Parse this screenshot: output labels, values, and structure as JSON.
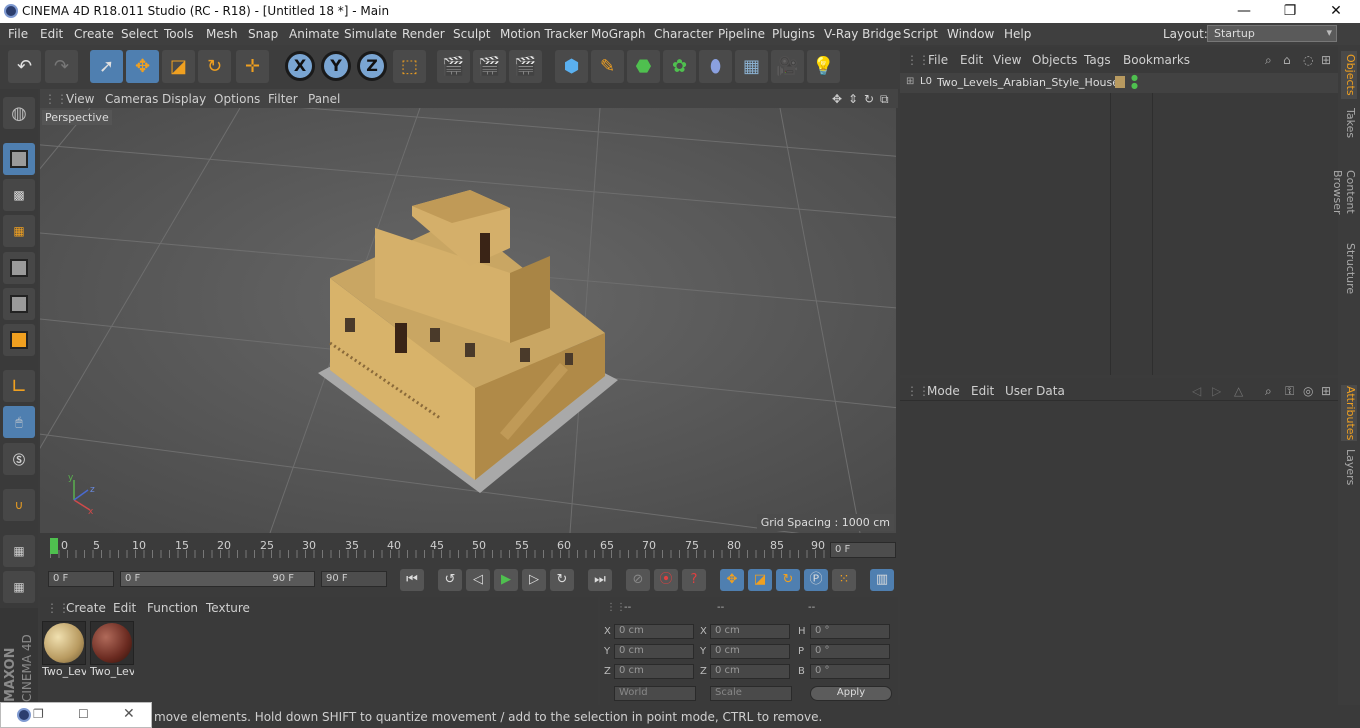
{
  "app": {
    "title": "CINEMA 4D R18.011 Studio (RC - R18) - [Untitled 18 *] - Main"
  },
  "menubar": {
    "items": [
      "File",
      "Edit",
      "Create",
      "Select",
      "Tools",
      "Mesh",
      "Snap",
      "Animate",
      "Simulate",
      "Render",
      "Sculpt",
      "Motion Tracker",
      "MoGraph",
      "Character",
      "Pipeline",
      "Plugins",
      "V-Ray Bridge",
      "Script",
      "Window",
      "Help"
    ],
    "layout_label": "Layout:",
    "layout_value": "Startup"
  },
  "toolbar": {
    "axis_x": "X",
    "axis_y": "Y",
    "axis_z": "Z"
  },
  "viewport": {
    "menu": [
      "View",
      "Cameras",
      "Display",
      "Options",
      "Filter",
      "Panel"
    ],
    "label": "Perspective",
    "grid_spacing": "Grid Spacing : 1000 cm"
  },
  "timeline": {
    "ticks": [
      "0",
      "5",
      "10",
      "15",
      "20",
      "25",
      "30",
      "35",
      "40",
      "45",
      "50",
      "55",
      "60",
      "65",
      "70",
      "75",
      "80",
      "85",
      "90"
    ],
    "current_frame": "0 F"
  },
  "playback": {
    "start": "0 F",
    "range_start": "0 F",
    "range_end": "90 F",
    "end": "90 F"
  },
  "materials": {
    "menu": [
      "Create",
      "Edit",
      "Function",
      "Texture"
    ],
    "items": [
      {
        "label": "Two_Lev"
      },
      {
        "label": "Two_Lev"
      }
    ]
  },
  "coords": {
    "headers": [
      "--",
      "--",
      "--"
    ],
    "rows": [
      {
        "a": "X",
        "av": "0 cm",
        "b": "X",
        "bv": "0 cm",
        "c": "H",
        "cv": "0 °"
      },
      {
        "a": "Y",
        "av": "0 cm",
        "b": "Y",
        "bv": "0 cm",
        "c": "P",
        "cv": "0 °"
      },
      {
        "a": "Z",
        "av": "0 cm",
        "b": "Z",
        "bv": "0 cm",
        "c": "B",
        "cv": "0 °"
      }
    ],
    "world": "World",
    "scale": "Scale",
    "apply": "Apply"
  },
  "objects": {
    "menu": [
      "File",
      "Edit",
      "View",
      "Objects",
      "Tags",
      "Bookmarks"
    ],
    "item": "Two_Levels_Arabian_Style_House"
  },
  "attributes": {
    "menu": [
      "Mode",
      "Edit",
      "User Data"
    ]
  },
  "sidetabs": [
    "Objects",
    "Takes",
    "Content Browser",
    "Structure",
    "Attributes",
    "Layers"
  ],
  "status": "move elements. Hold down SHIFT to quantize movement / add to the selection in point mode, CTRL to remove."
}
